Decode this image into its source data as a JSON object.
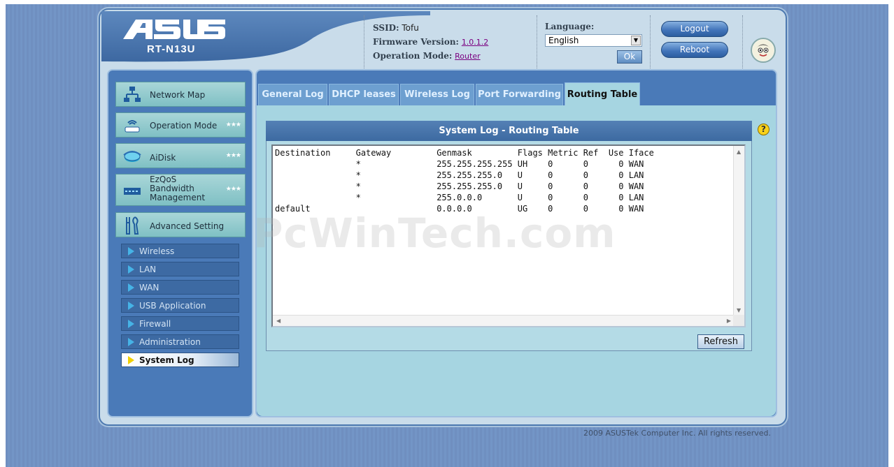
{
  "header": {
    "brand": "ASUS",
    "model": "RT-N13U",
    "ssid_label": "SSID:",
    "ssid_value": "Tofu",
    "firmware_label": "Firmware Version:",
    "firmware_value": "1.0.1.2",
    "opmode_label": "Operation Mode:",
    "opmode_value": "Router",
    "language_label": "Language:",
    "language_value": "English",
    "ok_label": "Ok",
    "logout_label": "Logout",
    "reboot_label": "Reboot"
  },
  "sidebar": {
    "main_items": [
      {
        "label": "Network Map",
        "icon": "network-map-icon"
      },
      {
        "label": "Operation Mode",
        "icon": "router-icon"
      },
      {
        "label": "AiDisk",
        "icon": "disk-icon"
      },
      {
        "label": "EzQoS Bandwidth Management",
        "line1": "EzQoS",
        "line2": "Bandwidth",
        "line3": "Management",
        "icon": "qos-icon"
      },
      {
        "label": "Advanced Setting",
        "icon": "tools-icon"
      }
    ],
    "sub_items": [
      {
        "label": "Wireless"
      },
      {
        "label": "LAN"
      },
      {
        "label": "WAN"
      },
      {
        "label": "USB Application"
      },
      {
        "label": "Firewall"
      },
      {
        "label": "Administration"
      },
      {
        "label": "System Log",
        "active": true
      }
    ]
  },
  "tabs": [
    {
      "label": "General Log"
    },
    {
      "label": "DHCP leases"
    },
    {
      "label": "Wireless Log"
    },
    {
      "label": "Port Forwarding"
    },
    {
      "label": "Routing Table",
      "active": true
    }
  ],
  "panel": {
    "title": "System Log - Routing Table",
    "refresh_label": "Refresh",
    "routing_table": {
      "columns": [
        "Destination",
        "Gateway",
        "Genmask",
        "Flags",
        "Metric",
        "Ref",
        "Use",
        "Iface"
      ],
      "rows": [
        [
          "",
          "*",
          "255.255.255.255",
          "UH",
          "0",
          "0",
          "0",
          "WAN"
        ],
        [
          "",
          "*",
          "255.255.255.0",
          "U",
          "0",
          "0",
          "0",
          "LAN"
        ],
        [
          "",
          "*",
          "255.255.255.0",
          "U",
          "0",
          "0",
          "0",
          "WAN"
        ],
        [
          "",
          "*",
          "255.0.0.0",
          "U",
          "0",
          "0",
          "0",
          "LAN"
        ],
        [
          "default",
          "",
          "0.0.0.0",
          "UG",
          "0",
          "0",
          "0",
          "WAN"
        ]
      ]
    }
  },
  "watermark": "PcWinTech.com",
  "footer": "2009 ASUSTek Computer Inc. All rights reserved.",
  "colors": {
    "frame_blue": "#4a7ab8",
    "panel_cyan": "#a6d5e1",
    "nav_teal": "#7fc0c4"
  }
}
